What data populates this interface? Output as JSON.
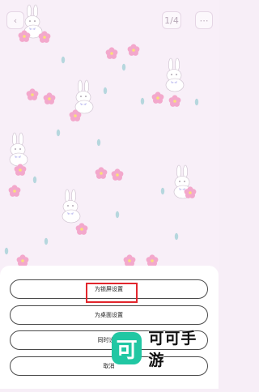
{
  "top_bar": {
    "left_icon": "chevron-left-icon",
    "page_label": "1/4",
    "right_icon": "more-icon"
  },
  "wallpaper": {
    "theme": "bunnies-and-flowers",
    "colors": {
      "background": "#f8eff8",
      "flower": "#f3a8cc",
      "leaf": "#b6d7de"
    }
  },
  "sheet": {
    "options": [
      {
        "label": "为锁屏设置",
        "highlighted": true
      },
      {
        "label": "为桌面设置",
        "highlighted": false
      },
      {
        "label": "同时设置",
        "highlighted": false
      },
      {
        "label": "取消",
        "highlighted": false
      }
    ]
  },
  "watermark": {
    "logo_char": "可",
    "text": "可可手游",
    "color": "#21c7a3"
  },
  "highlight_color": "#e2262d"
}
